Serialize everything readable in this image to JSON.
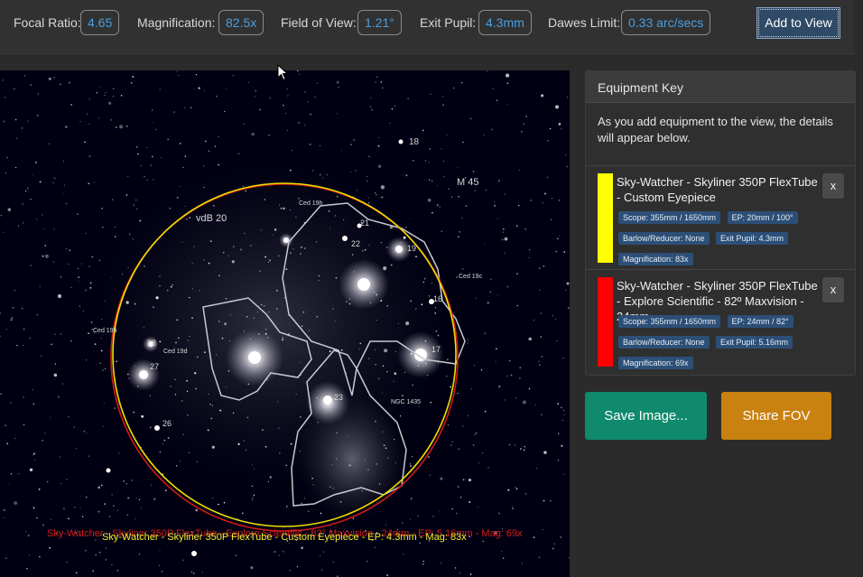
{
  "stats": [
    {
      "label": "Focal Ratio:",
      "value": "4.65"
    },
    {
      "label": "Magnification:",
      "value": "82.5x"
    },
    {
      "label": "Field of View:",
      "value": "1.21°"
    },
    {
      "label": "Exit Pupil:",
      "value": "4.3mm"
    },
    {
      "label": "Dawes Limit:",
      "value": "0.33 arc/secs"
    }
  ],
  "add_button": "Add to View",
  "sky": {
    "labels": [
      "18",
      "M 45",
      "Ced 19h",
      "vdB 20",
      "21",
      "22",
      "19",
      "Ced 19c",
      "16",
      "Ced 19b",
      "28",
      "Ced 19d",
      "27",
      "17",
      "23",
      "NGC 1435",
      "26"
    ],
    "overlay_red": "Sky-Watcher - Skyliner 350P FlexTube - Explore Scientific - 82° Maxvision - 24mm - EP: 5.16mm - Mag: 69x",
    "overlay_yellow": "Sky-Watcher - Skyliner 350P FlexTube - Custom Eyepiece - EP: 4.3mm - Mag: 83x",
    "colors": {
      "ring1": "#f5e400",
      "ring2": "#e01818"
    }
  },
  "panel": {
    "header": "Equipment Key",
    "intro": "As you add equipment to the view, the details will appear below.",
    "items": [
      {
        "color": "#ffff00",
        "name": "Sky-Watcher - Skyliner 350P FlexTube - Custom Eyepiece",
        "remove": "x",
        "badges": [
          "Scope: 355mm / 1650mm",
          "EP: 20mm / 100°",
          "Barlow/Reducer: None",
          "Exit Pupil: 4.3mm",
          "Magnification: 83x"
        ]
      },
      {
        "color": "#ff0000",
        "name": "Sky-Watcher - Skyliner 350P FlexTube - Explore Scientific - 82º Maxvision - 24mm",
        "remove": "x",
        "badges": [
          "Scope: 355mm / 1650mm",
          "EP: 24mm / 82°",
          "Barlow/Reducer: None",
          "Exit Pupil: 5.16mm",
          "Magnification: 69x"
        ]
      }
    ]
  },
  "buttons": {
    "save": "Save Image...",
    "share": "Share FOV"
  }
}
